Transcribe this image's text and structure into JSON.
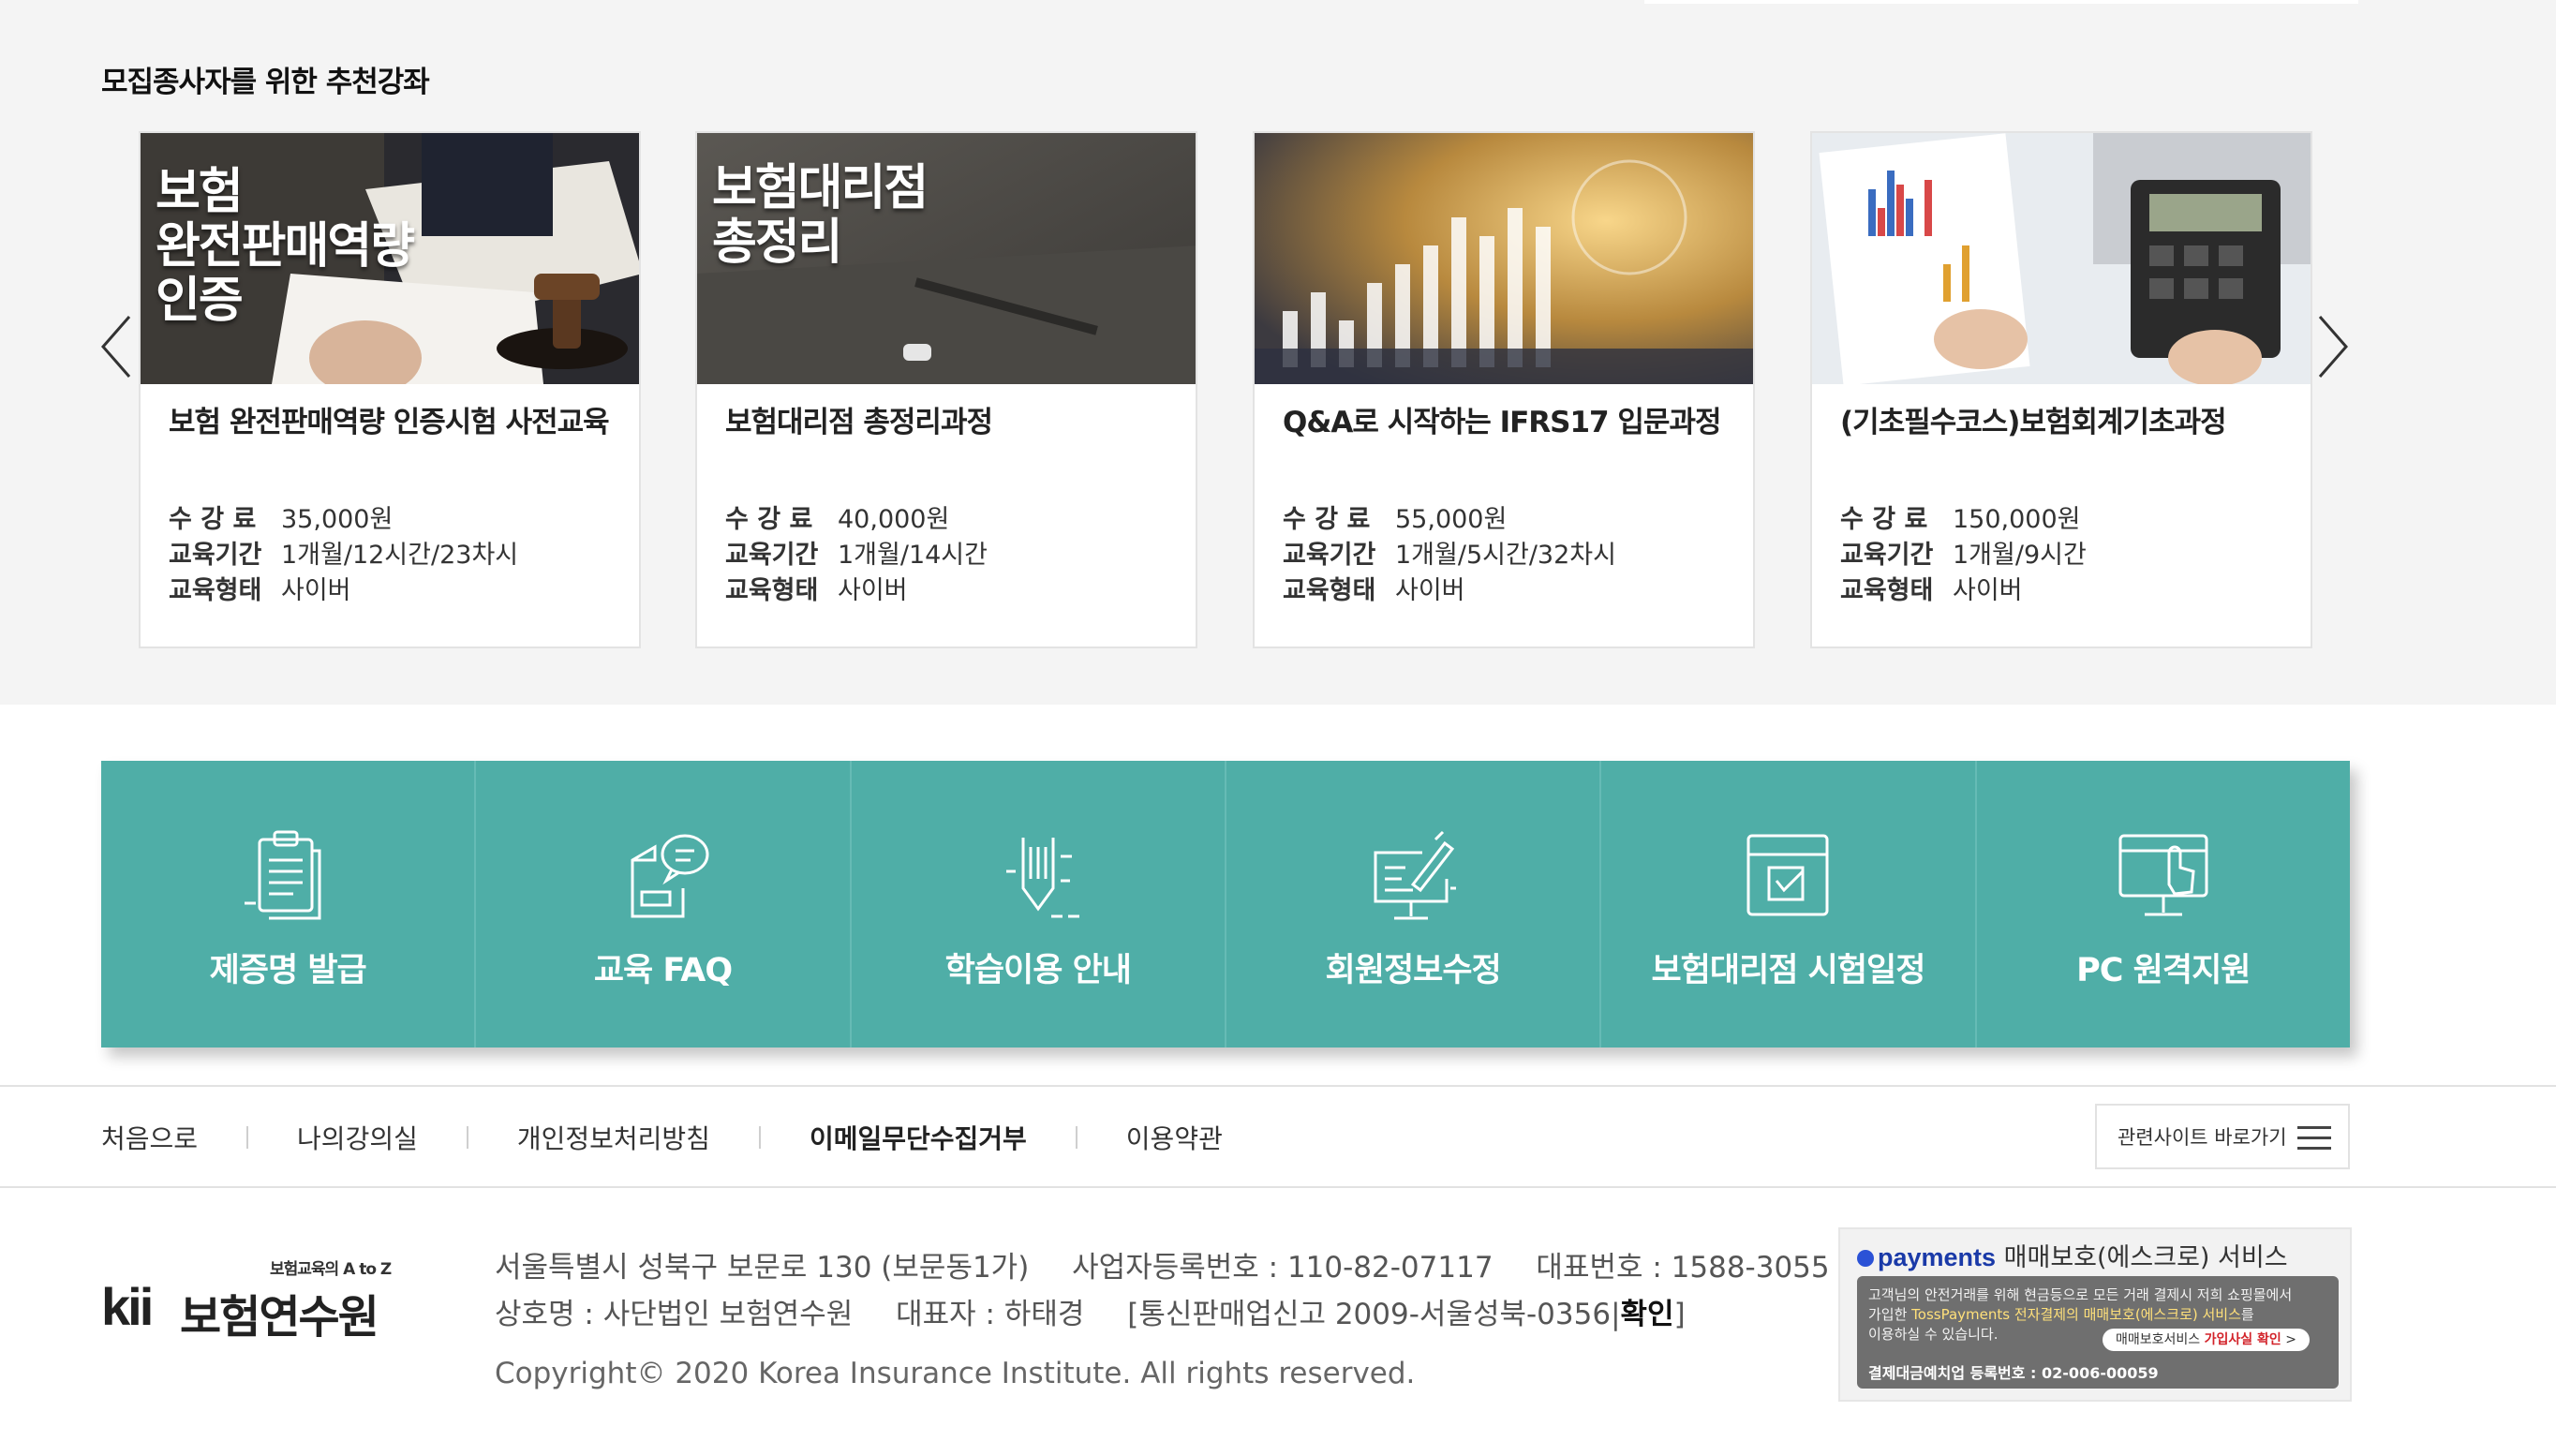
{
  "recommended": {
    "title": "모집종사자를 위한 추천강좌",
    "labels": {
      "fee": "수 강 료",
      "period": "교육기간",
      "type": "교육형태"
    },
    "courses": [
      {
        "thumb_lines": [
          "보험",
          "완전판매역량",
          "인증"
        ],
        "title": "보험 완전판매역량 인증시험 사전교육",
        "fee": "35,000원",
        "period": "1개월/12시간/23차시",
        "type": "사이버"
      },
      {
        "thumb_lines": [
          "보험대리점",
          "총정리"
        ],
        "title": "보험대리점 총정리과정",
        "fee": "40,000원",
        "period": "1개월/14시간",
        "type": "사이버"
      },
      {
        "thumb_lines": [],
        "title": "Q&A로 시작하는 IFRS17 입문과정",
        "fee": "55,000원",
        "period": "1개월/5시간/32차시",
        "type": "사이버"
      },
      {
        "thumb_lines": [],
        "title": "(기초필수코스)보험회계기초과정",
        "fee": "150,000원",
        "period": "1개월/9시간",
        "type": "사이버"
      }
    ]
  },
  "quick_menu": [
    {
      "label": "제증명 발급",
      "icon": "clipboard-document-icon"
    },
    {
      "label": "교육 FAQ",
      "icon": "document-chat-icon"
    },
    {
      "label": "학습이용 안내",
      "icon": "pen-guide-icon"
    },
    {
      "label": "회원정보수정",
      "icon": "monitor-edit-icon"
    },
    {
      "label": "보험대리점 시험일정",
      "icon": "calendar-check-icon"
    },
    {
      "label": "PC 원격지원",
      "icon": "monitor-pointer-icon"
    }
  ],
  "footer_nav": {
    "links": [
      "처음으로",
      "나의강의실",
      "개인정보처리방침",
      "이메일무단수집거부",
      "이용약관"
    ],
    "related_sites": "관련사이트 바로가기"
  },
  "footer": {
    "logo_tagline": "보험교육의 A to Z",
    "logo_brand": "kii",
    "logo_name": "보험연수원",
    "address": "서울특별시 성북구 보문로 130 (보문동1가)",
    "business_no": "사업자등록번호 : 110-82-07117",
    "phone": "대표번호 : 1588-3055",
    "company": "상호명 : 사단법인 보험연수원",
    "ceo": "대표자 : 하태경",
    "mail_order_prefix": "[통신판매업신고 2009-서울성북-0356|",
    "mail_order_confirm": "확인",
    "mail_order_suffix": "]",
    "copyright": "Copyright© 2020 Korea Insurance Institute. All rights reserved."
  },
  "escrow": {
    "brand": "payments",
    "service": "매매보호(에스크로) 서비스",
    "text_line1": "고객님의 안전거래를 위해 현금등으로 모든 거래 결제시 저희 쇼핑몰에서",
    "text_line2_prefix": "가입한 ",
    "text_line2_highlight": "TossPayments 전자결제의 매매보호(에스크로) 서비스",
    "text_line2_suffix": "를",
    "text_line3": "이용하실 수 있습니다.",
    "button_prefix": "매매보호서비스 ",
    "button_highlight": "가입사실 확인",
    "button_suffix": " >",
    "registration": "결제대금예치업 등록번호 : 02-006-00059"
  }
}
